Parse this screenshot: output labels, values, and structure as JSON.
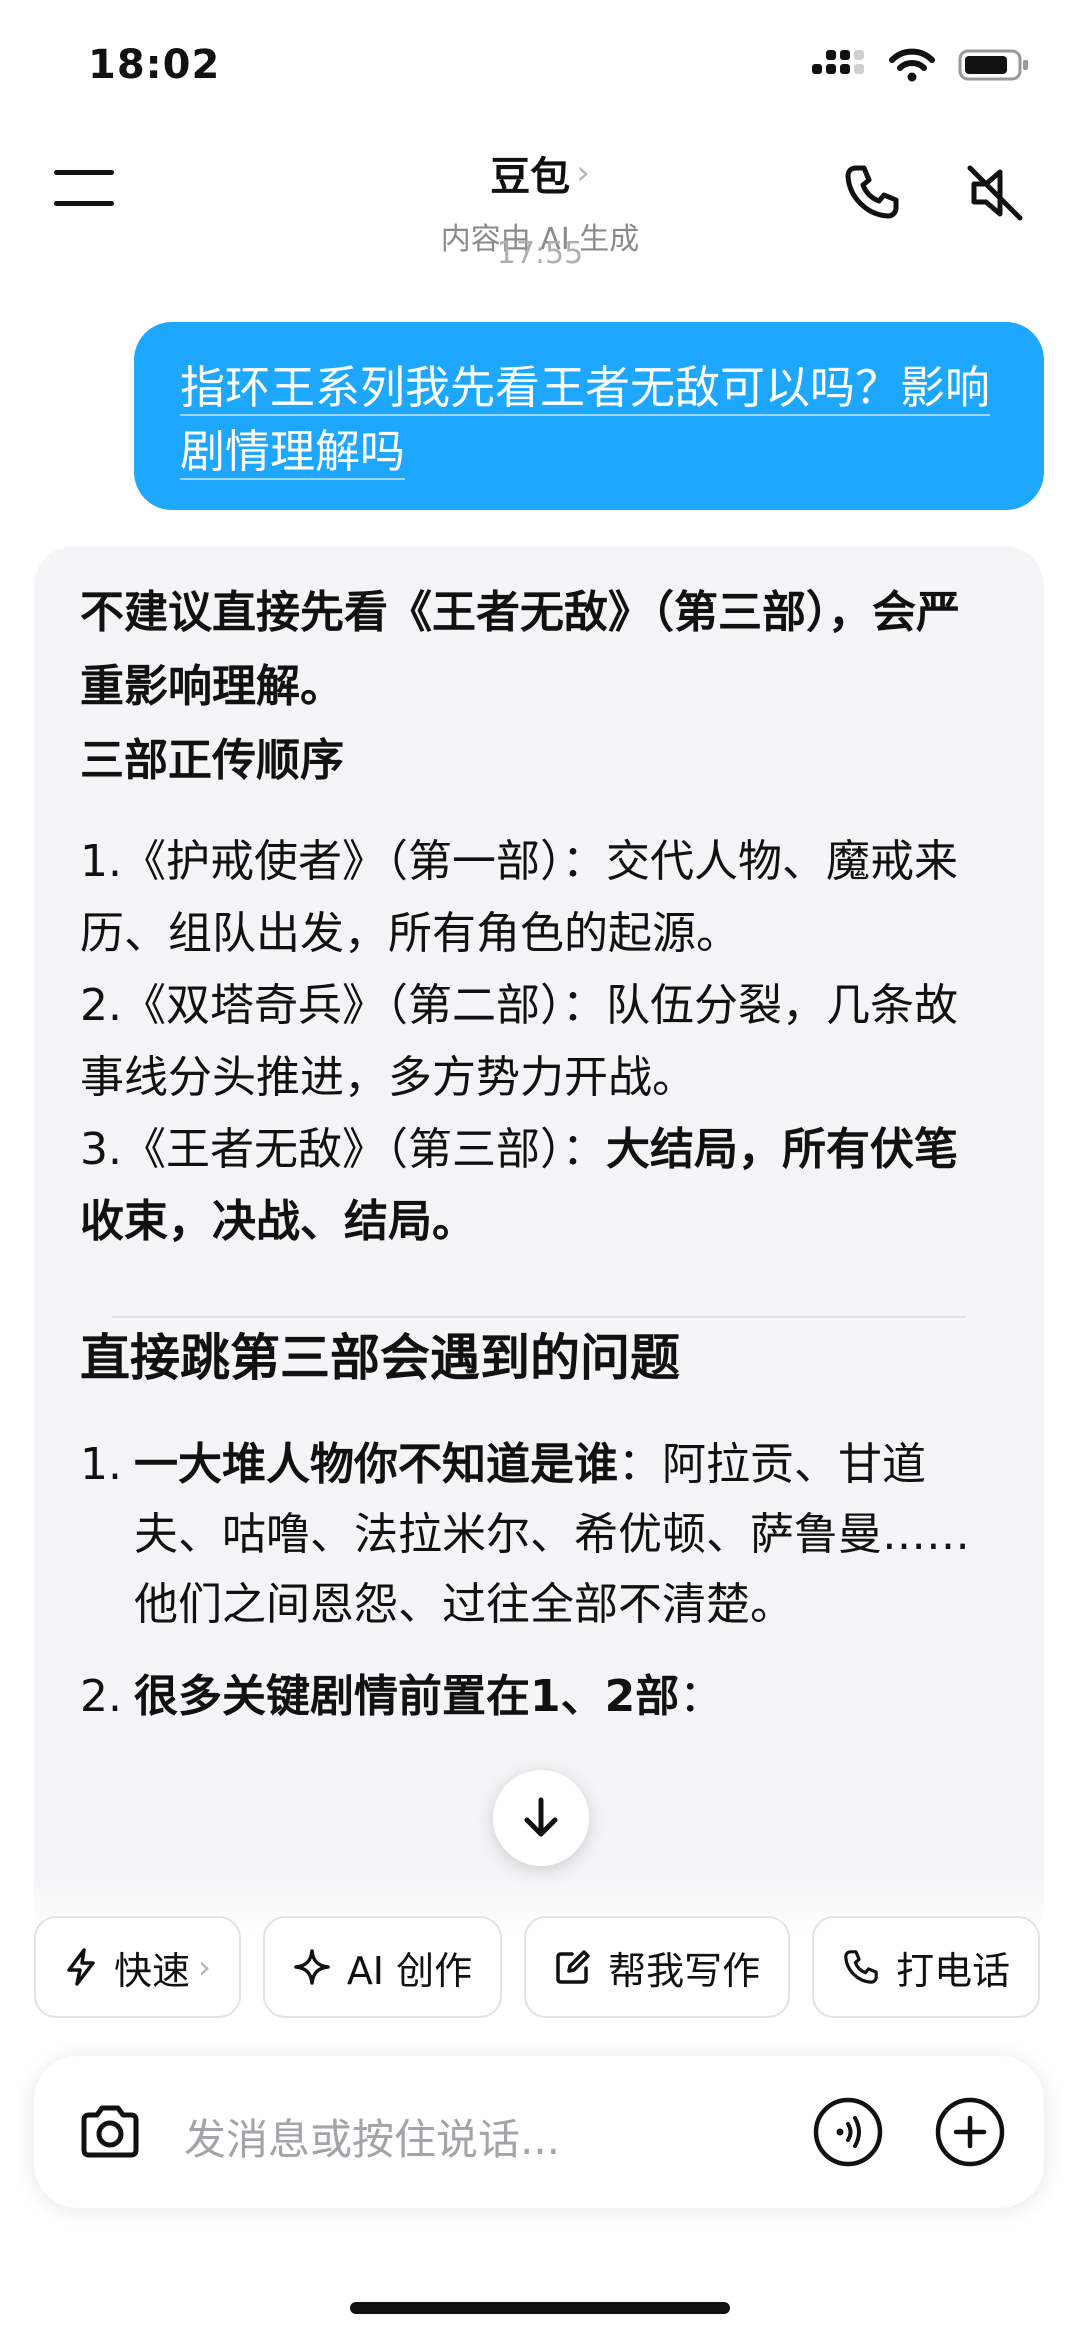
{
  "status_bar": {
    "time": "18:02"
  },
  "header": {
    "title": "豆包",
    "subtitle": "内容由 AI 生成",
    "message_time": "17:55"
  },
  "user_message": {
    "text": "指环王系列我先看王者无敌可以吗？影响剧情理解吗"
  },
  "ai_message": {
    "lead": "不建议直接先看《王者无敌》（第三部），会严重影响理解。",
    "section1_title": "三部正传顺序",
    "items": [
      {
        "text": "1.《护戒使者》（第一部）：交代人物、魔戒来历、组队出发，所有角色的起源。"
      },
      {
        "text": "2.《双塔奇兵》（第二部）：队伍分裂，几条故事线分头推进，多方势力开战。"
      },
      {
        "prefix": "3.《王者无敌》（第三部）：",
        "bold": "大结局，所有伏笔收束，决战、结局。"
      }
    ],
    "section2_title": "直接跳第三部会遇到的问题",
    "issues": [
      {
        "num": "1.",
        "bold": "一大堆人物你不知道是谁",
        "text": "：阿拉贡、甘道夫、咕噜、法拉米尔、希优顿、萨鲁曼……他们之间恩怨、过往全部不清楚。"
      },
      {
        "num": "2.",
        "bold": "很多关键剧情前置在1、2部",
        "text": "："
      }
    ]
  },
  "quick_actions": [
    {
      "label": "快速",
      "icon": "lightning-icon",
      "has_chevron": true
    },
    {
      "label": "AI 创作",
      "icon": "sparkle-icon"
    },
    {
      "label": "帮我写作",
      "icon": "edit-icon"
    },
    {
      "label": "打电话",
      "icon": "phone-icon"
    }
  ],
  "input": {
    "placeholder": "发消息或按住说话..."
  },
  "colors": {
    "user_bubble": "#1ea7ff",
    "ai_bubble": "#f5f5f7"
  }
}
